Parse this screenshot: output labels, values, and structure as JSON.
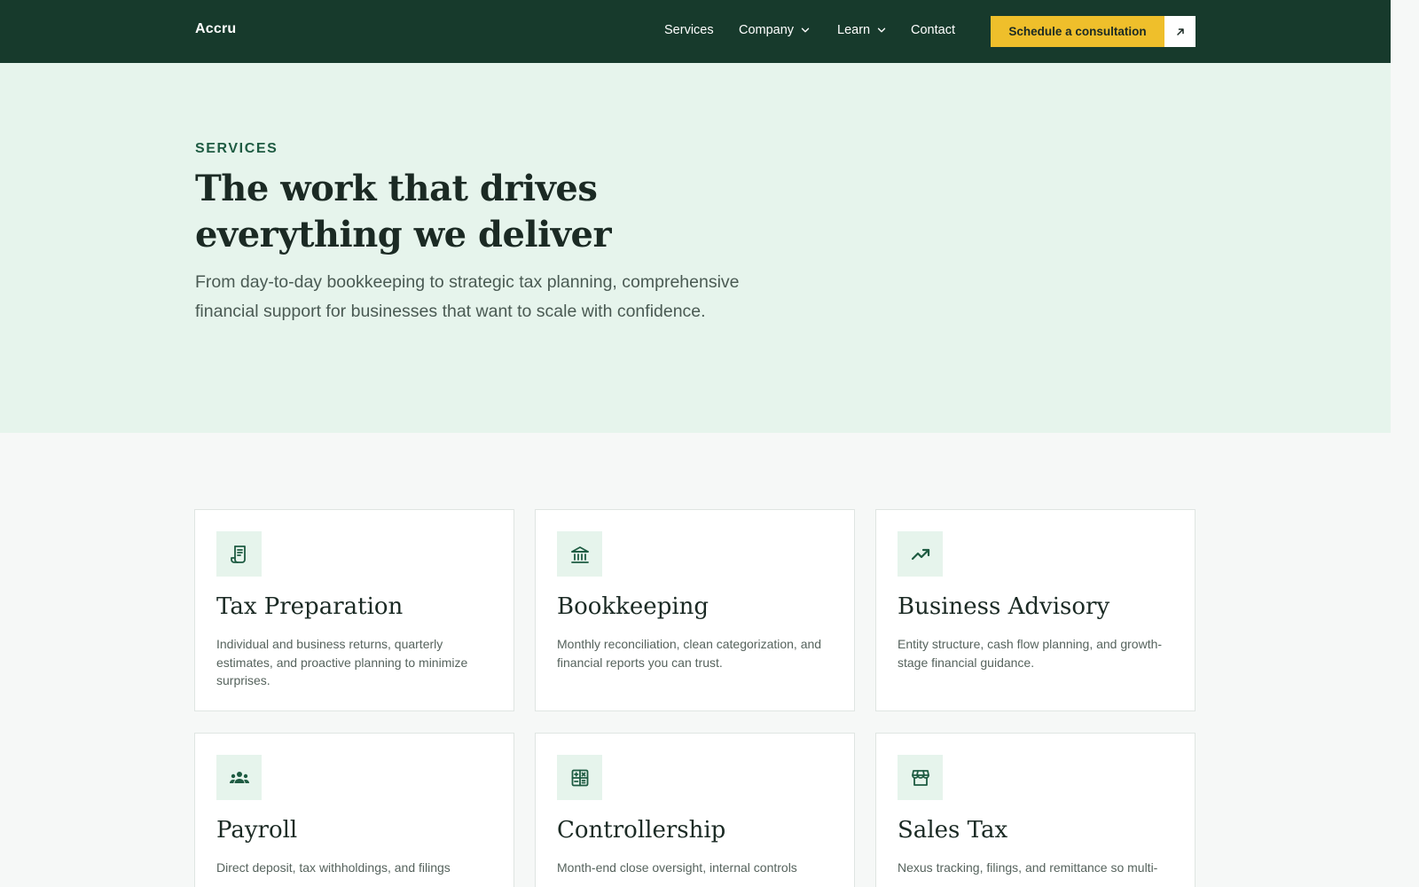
{
  "navbar": {
    "brand": "Accru",
    "links": [
      {
        "label": "Services"
      },
      {
        "label": "Company"
      },
      {
        "label": "Learn"
      },
      {
        "label": "Contact"
      }
    ],
    "cta_label": "Schedule a consultation"
  },
  "hero": {
    "eyebrow": "SERVICES",
    "title": "The work that drives everything we deliver",
    "description": "From day-to-day bookkeeping to strategic tax planning, comprehensive financial support for businesses that want to scale with confidence."
  },
  "services": [
    {
      "icon": "receipt-icon",
      "title": "Tax Preparation",
      "description": "Individual and business returns, quarterly estimates, and proactive planning to minimize surprises."
    },
    {
      "icon": "bank-icon",
      "title": "Bookkeeping",
      "description": "Monthly reconciliation, clean categorization, and financial reports you can trust."
    },
    {
      "icon": "trending-up-icon",
      "title": "Business Advisory",
      "description": "Entity structure, cash flow planning, and growth-stage financial guidance."
    },
    {
      "icon": "people-icon",
      "title": "Payroll",
      "description": "Direct deposit, tax withholdings, and filings"
    },
    {
      "icon": "calculator-icon",
      "title": "Controllership",
      "description": "Month-end close oversight, internal controls"
    },
    {
      "icon": "storefront-icon",
      "title": "Sales Tax",
      "description": "Nexus tracking, filings, and remittance so multi-"
    }
  ],
  "colors": {
    "nav_bg": "#173a2c",
    "hero_bg": "#e6f4ec",
    "accent": "#efbf2b",
    "icon_green": "#1e5b42"
  }
}
